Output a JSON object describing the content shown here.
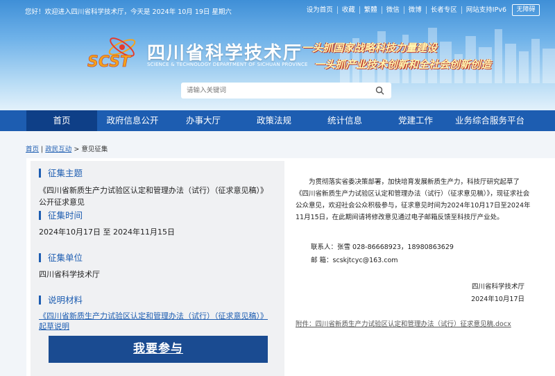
{
  "topbar": {
    "welcome": "您好！欢迎进入四川省科学技术厅，今天是  2024年 10月 19日  星期六",
    "links": [
      "设为首页",
      "收藏",
      "繁體",
      "微信",
      "微博",
      "长者专区",
      "网站支持IPv6"
    ],
    "accessibility": "无障碍"
  },
  "logo": {
    "emblem_text": "SCST",
    "cn_name": "四川省科学技术厅",
    "en_name": "SCIENCE & TECHNOLOGY DEPARTMENT OF SICHUAN PROVINCE"
  },
  "slogans": [
    "一头抓国家战略科技力量建设",
    "一头抓产业技术创新和全社会创新创造"
  ],
  "search": {
    "placeholder": "请输入关键词",
    "icon": "search-icon"
  },
  "nav": {
    "items": [
      "首页",
      "政府信息公开",
      "办事大厅",
      "政策法规",
      "统计信息",
      "党建工作",
      "业务综合服务平台"
    ],
    "active": 0
  },
  "breadcrumb": {
    "home": "首页",
    "section": "政民互动",
    "current": "意见征集"
  },
  "left": {
    "topic_title": "征集主题",
    "topic": "《四川省新质生产力试验区认定和管理办法（试行）（征求意见稿）》公开征求意见",
    "time_title": "征集时间",
    "time": "2024年10月17日 至 2024年11月15日",
    "unit_title": "征集单位",
    "unit": "四川省科学技术厅",
    "doc_title": "说明材料",
    "doc_link": "《四川省新质生产力试验区认定和管理办法（试行）（征求意见稿）》起草说明",
    "button": "我要参与"
  },
  "right": {
    "paragraph": "为贯彻落实省委决策部署，加快培育发展新质生产力，科技厅研究起草了《四川省新质生产力试验区认定和管理办法（试行）（征求意见稿）》，现征求社会公众意见，欢迎社会公众积极参与，征求意见时间为2024年10月17日至2024年11月15日，在此期间请将修改意见通过电子邮箱反馈至科技厅产业处。",
    "contact": "联系人：张雪  028-86668923，18980863629",
    "email": "邮    箱：scskjtcyc@163.com",
    "org": "四川省科学技术厅",
    "date": "2024年10月17日",
    "attachment": "附件：四川省新质生产力试验区认定和管理办法（试行）征求意见稿.docx"
  },
  "colors": {
    "brand_blue": "#1d5db1",
    "nav_active": "#0e3f87",
    "button": "#1a4b91"
  }
}
